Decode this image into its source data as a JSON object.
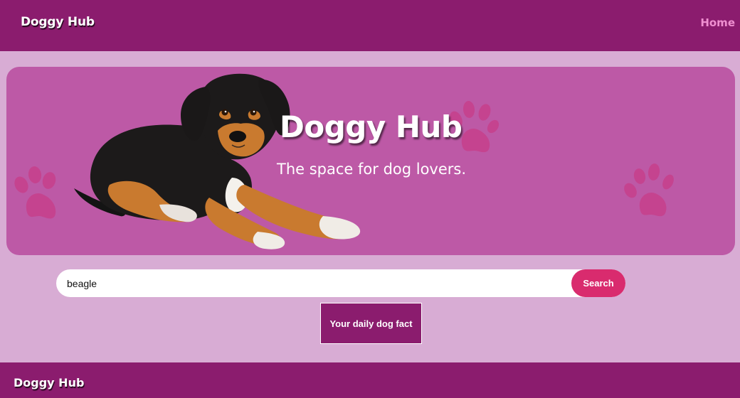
{
  "nav": {
    "brand": "Doggy Hub",
    "links": [
      {
        "label": "Home"
      }
    ]
  },
  "hero": {
    "title": "Doggy Hub",
    "subtitle": "The space for dog lovers."
  },
  "search": {
    "value": "beagle",
    "button_label": "Search"
  },
  "fact_button_label": "Your daily dog fact",
  "footer": {
    "brand": "Doggy Hub"
  },
  "colors": {
    "nav_bg": "#8b1c6e",
    "page_bg": "#d8acd4",
    "hero_bg": "#bd59a6",
    "accent_pink": "#d92b6e",
    "home_link": "#ef8fd0"
  },
  "icons": [
    "paw-print-icon",
    "puppy-image"
  ]
}
